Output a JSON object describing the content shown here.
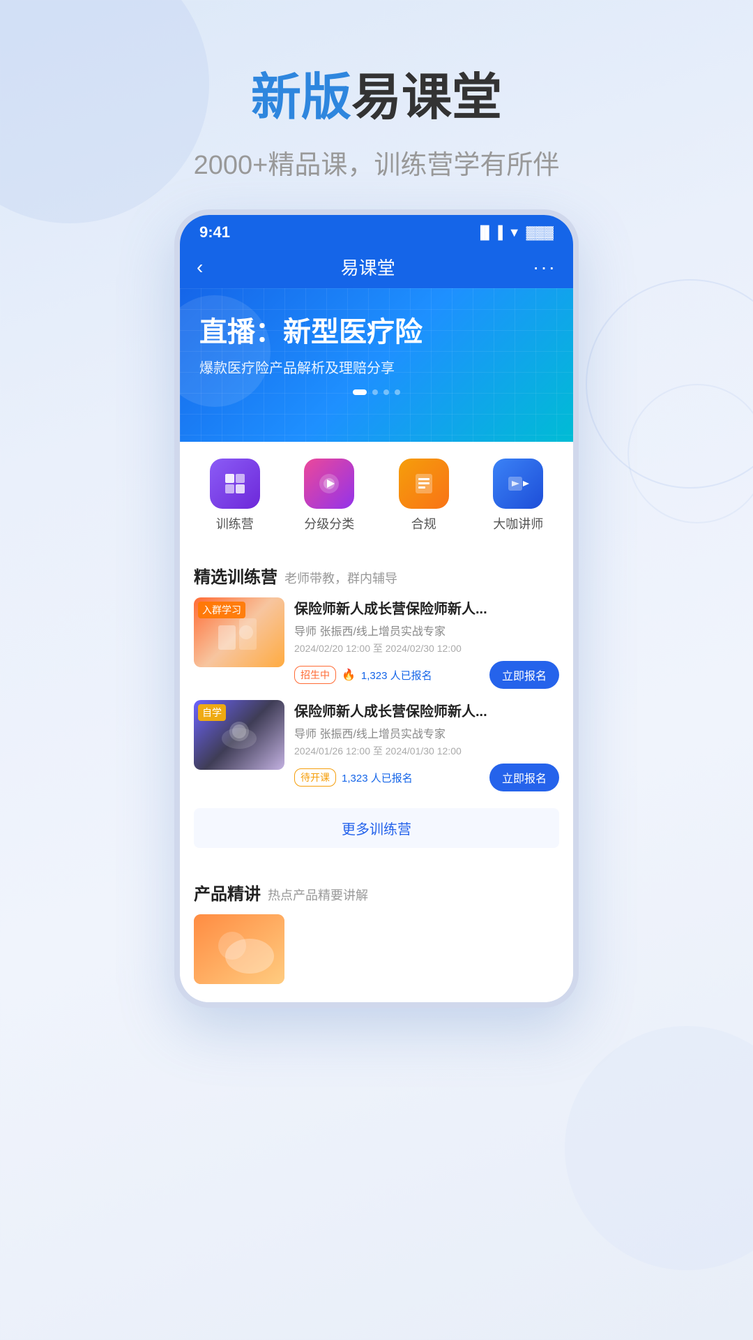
{
  "page": {
    "background": "#dce8f8"
  },
  "header": {
    "title_highlight": "新版",
    "title_rest": "易课堂",
    "subtitle": "2000+精品课，训练营学有所伴"
  },
  "phone": {
    "status_bar": {
      "time": "9:41",
      "signal_icon": "📶",
      "wifi_icon": "📡",
      "battery_icon": "🔋"
    },
    "nav": {
      "back_icon": "‹",
      "title": "易课堂",
      "more_icon": "···"
    },
    "banner": {
      "title": "直播：新型医疗险",
      "subtitle": "爆款医疗险产品解析及理赔分享",
      "dots": [
        "active",
        "inactive",
        "inactive",
        "inactive"
      ]
    },
    "categories": [
      {
        "id": "training-camp",
        "label": "训练营",
        "color_class": "cat-purple",
        "icon": "🗂"
      },
      {
        "id": "grade-category",
        "label": "分级分类",
        "color_class": "cat-pink",
        "icon": "▶"
      },
      {
        "id": "compliance",
        "label": "合规",
        "color_class": "cat-orange",
        "icon": "📋"
      },
      {
        "id": "expert-teacher",
        "label": "大咖讲师",
        "color_class": "cat-blue",
        "icon": "▶"
      }
    ],
    "selected_section": {
      "title": "精选训练营",
      "subtitle": "老师带教，群内辅导",
      "courses": [
        {
          "id": "course-1",
          "thumb_type": "warm",
          "badge": "入群学习",
          "name": "保险师新人成长营保险师新人...",
          "teacher": "导师 张振西/线上增员实战专家",
          "date_range": "2024/02/20 12:00 至 2024/02/30 12:00",
          "status_tag": "招生中",
          "status_tag_type": "recruiting",
          "count_text": "1,323 人已报名",
          "btn_label": "立即报名"
        },
        {
          "id": "course-2",
          "thumb_type": "cool",
          "badge": "自学",
          "name": "保险师新人成长营保险师新人...",
          "teacher": "导师 张振西/线上增员实战专家",
          "date_range": "2024/01/26 12:00 至 2024/01/30 12:00",
          "status_tag": "待开课",
          "status_tag_type": "pending",
          "count_text": "1,323 人已报名",
          "btn_label": "立即报名"
        }
      ],
      "more_btn_label": "更多训练营"
    },
    "product_section": {
      "title": "产品精讲",
      "subtitle": "热点产品精要讲解"
    }
  }
}
